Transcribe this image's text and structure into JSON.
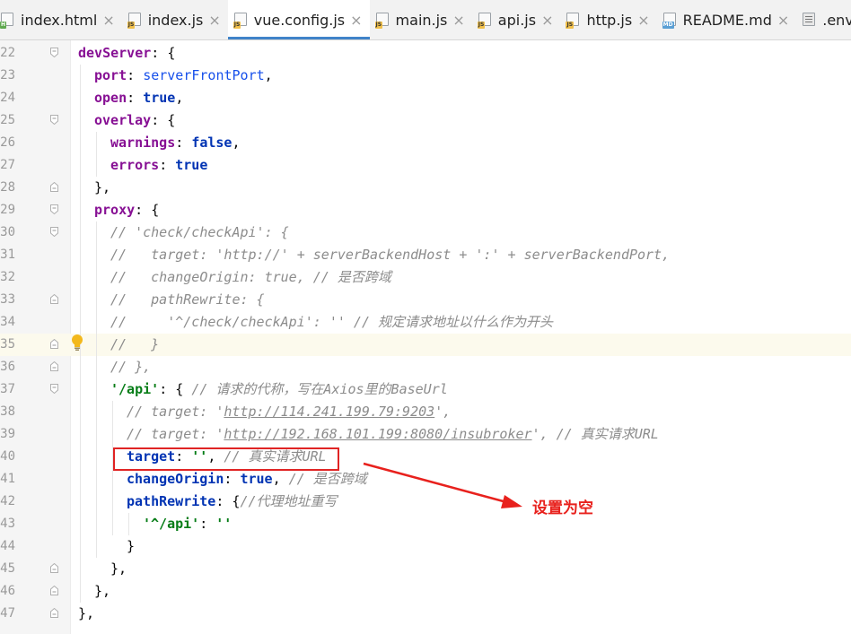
{
  "tabs": [
    {
      "label": "index.html",
      "icon": "html-file-icon",
      "badge": "H",
      "active": false
    },
    {
      "label": "index.js",
      "icon": "js-file-icon",
      "badge": "JS",
      "active": false
    },
    {
      "label": "vue.config.js",
      "icon": "js-file-icon",
      "badge": "JS",
      "active": true
    },
    {
      "label": "main.js",
      "icon": "js-file-icon",
      "badge": "JS",
      "active": false
    },
    {
      "label": "api.js",
      "icon": "js-file-icon",
      "badge": "JS",
      "active": false
    },
    {
      "label": "http.js",
      "icon": "js-file-icon",
      "badge": "JS",
      "active": false
    },
    {
      "label": "README.md",
      "icon": "md-file-icon",
      "badge": "MD",
      "active": false
    },
    {
      "label": ".env",
      "icon": "text-file-icon",
      "badge": "",
      "active": false
    }
  ],
  "close_glyph": "×",
  "current_line": "35",
  "lines": [
    {
      "n": "22",
      "indent": 0,
      "tokens": [
        [
          "prop",
          "devServer"
        ],
        [
          "pn",
          ": {"
        ]
      ]
    },
    {
      "n": "23",
      "indent": 1,
      "tokens": [
        [
          "prop",
          "port"
        ],
        [
          "pn",
          ": "
        ],
        [
          "id",
          "serverFrontPort"
        ],
        [
          "pn",
          ","
        ]
      ]
    },
    {
      "n": "24",
      "indent": 1,
      "tokens": [
        [
          "prop",
          "open"
        ],
        [
          "pn",
          ": "
        ],
        [
          "kw",
          "true"
        ],
        [
          "pn",
          ","
        ]
      ]
    },
    {
      "n": "25",
      "indent": 1,
      "tokens": [
        [
          "prop",
          "overlay"
        ],
        [
          "pn",
          ": {"
        ]
      ]
    },
    {
      "n": "26",
      "indent": 2,
      "tokens": [
        [
          "prop",
          "warnings"
        ],
        [
          "pn",
          ": "
        ],
        [
          "kw",
          "false"
        ],
        [
          "pn",
          ","
        ]
      ]
    },
    {
      "n": "27",
      "indent": 2,
      "tokens": [
        [
          "prop",
          "errors"
        ],
        [
          "pn",
          ": "
        ],
        [
          "kw",
          "true"
        ]
      ]
    },
    {
      "n": "28",
      "indent": 1,
      "tokens": [
        [
          "pn",
          "},"
        ]
      ]
    },
    {
      "n": "29",
      "indent": 1,
      "tokens": [
        [
          "prop",
          "proxy"
        ],
        [
          "pn",
          ": {"
        ]
      ]
    },
    {
      "n": "30",
      "indent": 2,
      "tokens": [
        [
          "cm",
          "// 'check/checkApi': {"
        ]
      ]
    },
    {
      "n": "31",
      "indent": 2,
      "tokens": [
        [
          "cm",
          "//   target: 'http://' + serverBackendHost + ':' + serverBackendPort,"
        ]
      ]
    },
    {
      "n": "32",
      "indent": 2,
      "tokens": [
        [
          "cm",
          "//   changeOrigin: true, // 是否跨域"
        ]
      ]
    },
    {
      "n": "33",
      "indent": 2,
      "tokens": [
        [
          "cm",
          "//   pathRewrite: {"
        ]
      ]
    },
    {
      "n": "34",
      "indent": 2,
      "tokens": [
        [
          "cm",
          "//     '^/check/checkApi': '' // 规定请求地址以什么作为开头"
        ]
      ]
    },
    {
      "n": "35",
      "indent": 2,
      "tokens": [
        [
          "cm",
          "//   }"
        ]
      ]
    },
    {
      "n": "36",
      "indent": 2,
      "tokens": [
        [
          "cm",
          "// },"
        ]
      ]
    },
    {
      "n": "37",
      "indent": 2,
      "tokens": [
        [
          "str",
          "'/api'"
        ],
        [
          "pn",
          ": { "
        ],
        [
          "cm",
          "// 请求的代称，写在Axios里的BaseUrl"
        ]
      ]
    },
    {
      "n": "38",
      "indent": 3,
      "tokens": [
        [
          "cm",
          "// target: '"
        ],
        [
          "cmlink",
          "http://114.241.199.79:9203"
        ],
        [
          "cm",
          "',"
        ]
      ]
    },
    {
      "n": "39",
      "indent": 3,
      "tokens": [
        [
          "cm",
          "// target: '"
        ],
        [
          "cmlink",
          "http://192.168.101.199:8080/insubroker"
        ],
        [
          "cm",
          "', // 真实请求URL"
        ]
      ]
    },
    {
      "n": "40",
      "indent": 3,
      "tokens": [
        [
          "key",
          "target"
        ],
        [
          "pn",
          ": "
        ],
        [
          "str",
          "''"
        ],
        [
          "pn",
          ", "
        ],
        [
          "cm",
          "// 真实请求URL"
        ]
      ]
    },
    {
      "n": "41",
      "indent": 3,
      "tokens": [
        [
          "key",
          "changeOrigin"
        ],
        [
          "pn",
          ": "
        ],
        [
          "kw",
          "true"
        ],
        [
          "pn",
          ", "
        ],
        [
          "cm",
          "// 是否跨域"
        ]
      ]
    },
    {
      "n": "42",
      "indent": 3,
      "tokens": [
        [
          "key",
          "pathRewrite"
        ],
        [
          "pn",
          ": {"
        ],
        [
          "cm",
          "//代理地址重写"
        ]
      ]
    },
    {
      "n": "43",
      "indent": 4,
      "tokens": [
        [
          "str",
          "'^/api'"
        ],
        [
          "pn",
          ": "
        ],
        [
          "str",
          "''"
        ]
      ]
    },
    {
      "n": "44",
      "indent": 3,
      "tokens": [
        [
          "pn",
          "}"
        ]
      ]
    },
    {
      "n": "45",
      "indent": 2,
      "tokens": [
        [
          "pn",
          "},"
        ]
      ]
    },
    {
      "n": "46",
      "indent": 1,
      "tokens": [
        [
          "pn",
          "},"
        ]
      ]
    },
    {
      "n": "47",
      "indent": 0,
      "tokens": [
        [
          "pn",
          "},"
        ]
      ]
    }
  ],
  "annotation": {
    "text": "设置为空",
    "color": "#e8211d"
  },
  "colors": {
    "accent": "#4083c9",
    "highlight_box": "#e02424",
    "current_line_bg": "#fcfaed"
  }
}
